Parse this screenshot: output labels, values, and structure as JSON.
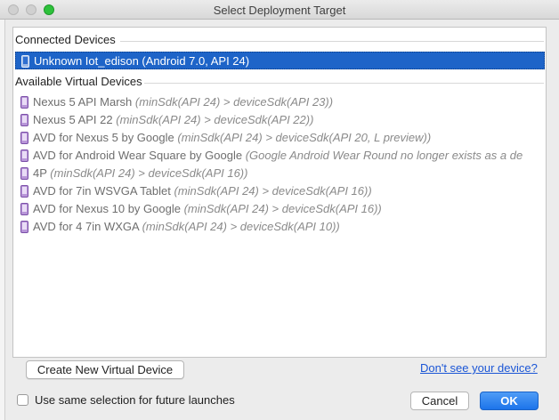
{
  "window": {
    "title": "Select Deployment Target"
  },
  "connected": {
    "header": "Connected Devices",
    "devices": [
      {
        "name": "Unknown Iot_edison (Android 7.0, API 24)",
        "icon": "phone-icon"
      }
    ]
  },
  "available": {
    "header": "Available Virtual Devices",
    "devices": [
      {
        "name": "Nexus 5 API Marsh",
        "detail": "(minSdk(API 24) > deviceSdk(API 23))",
        "icon": "phone-icon"
      },
      {
        "name": "Nexus 5 API 22",
        "detail": "(minSdk(API 24) > deviceSdk(API 22))",
        "icon": "phone-icon"
      },
      {
        "name": "AVD for Nexus 5 by Google",
        "detail": "(minSdk(API 24) > deviceSdk(API 20, L preview))",
        "icon": "phone-icon"
      },
      {
        "name": "AVD for Android Wear Square by Google",
        "detail": "(Google Android Wear Round no longer exists as a de",
        "icon": "phone-icon"
      },
      {
        "name": "4P",
        "detail": "(minSdk(API 24) > deviceSdk(API 16))",
        "icon": "phone-icon"
      },
      {
        "name": "AVD for 7in WSVGA Tablet",
        "detail": "(minSdk(API 24) > deviceSdk(API 16))",
        "icon": "phone-icon"
      },
      {
        "name": "AVD for Nexus 10 by Google",
        "detail": "(minSdk(API 24) > deviceSdk(API 16))",
        "icon": "phone-icon"
      },
      {
        "name": "AVD for 4 7in WXGA",
        "detail": "(minSdk(API 24) > deviceSdk(API 10))",
        "icon": "phone-icon"
      }
    ]
  },
  "actions": {
    "create_label": "Create New Virtual Device",
    "help_link": "Don't see your device?",
    "same_selection_label": "Use same selection for future launches",
    "same_selection_checked": false,
    "cancel_label": "Cancel",
    "ok_label": "OK"
  },
  "colors": {
    "selection": "#1e64c8",
    "link": "#1b56d6",
    "primary_button": "#1c74ea",
    "device_icon": "#7b4fa8"
  }
}
